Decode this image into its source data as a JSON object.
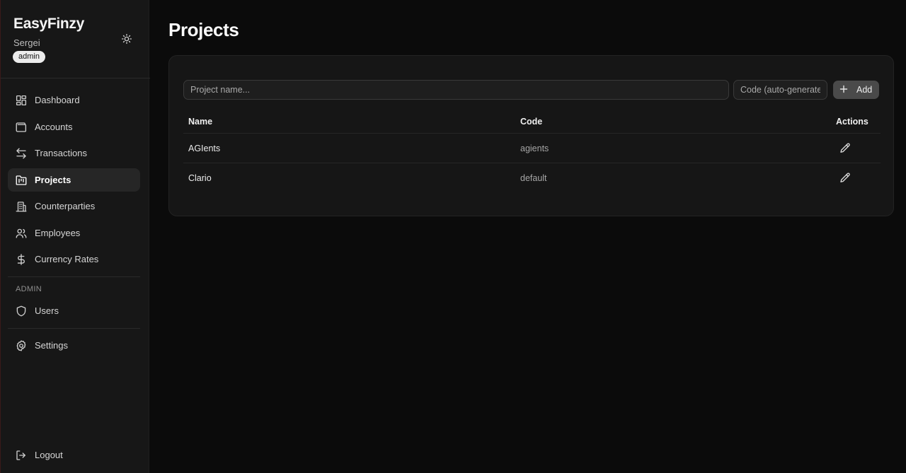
{
  "app": {
    "brand": "EasyFinzy",
    "user": "Sergei",
    "role": "admin"
  },
  "nav": {
    "items": [
      {
        "label": "Dashboard",
        "icon": "dashboard-icon"
      },
      {
        "label": "Accounts",
        "icon": "wallet-icon"
      },
      {
        "label": "Transactions",
        "icon": "arrows-left-right-icon"
      },
      {
        "label": "Projects",
        "icon": "folder-kanban-icon",
        "active": true
      },
      {
        "label": "Counterparties",
        "icon": "building-icon"
      },
      {
        "label": "Employees",
        "icon": "users-icon"
      },
      {
        "label": "Currency Rates",
        "icon": "dollar-icon"
      }
    ],
    "admin_section_label": "ADMIN",
    "admin_items": [
      {
        "label": "Users",
        "icon": "shield-icon"
      }
    ],
    "settings": {
      "label": "Settings",
      "icon": "gear-icon"
    },
    "logout": {
      "label": "Logout",
      "icon": "logout-icon"
    }
  },
  "page": {
    "title": "Projects"
  },
  "form": {
    "name_placeholder": "Project name...",
    "code_placeholder": "Code (auto-generate",
    "add_label": "Add"
  },
  "table": {
    "headers": {
      "name": "Name",
      "code": "Code",
      "actions": "Actions"
    },
    "rows": [
      {
        "name": "AGIents",
        "code": "agients"
      },
      {
        "name": "Clario",
        "code": "default"
      }
    ]
  },
  "colors": {
    "background": "#0b0b0b",
    "sidebar": "#171717",
    "card": "#161616",
    "active_nav": "#262626",
    "add_button": "#4a4a4a"
  }
}
